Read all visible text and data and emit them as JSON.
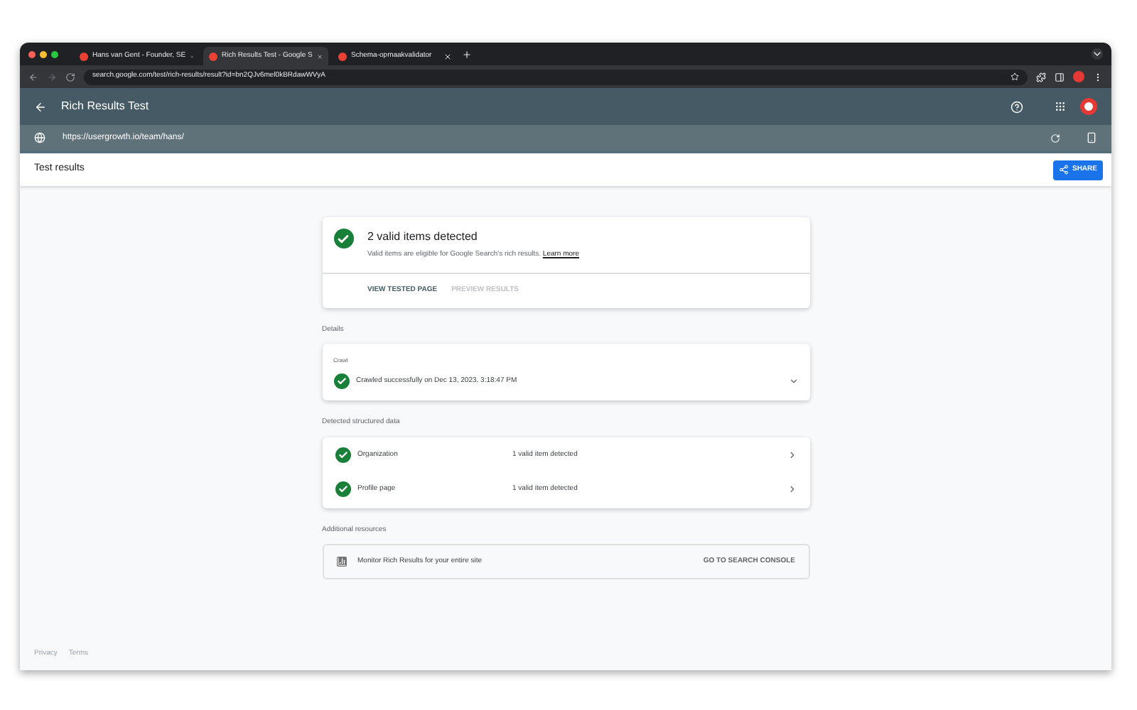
{
  "browser_tabs": [
    {
      "title": "Hans van Gent - Founder, SE",
      "selected": false
    },
    {
      "title": "Rich Results Test - Google S",
      "selected": true
    },
    {
      "title": "Schema-opmaakvalidator",
      "selected": false
    }
  ],
  "address": "search.google.com/test/rich-results/result?id=bn2QJv6mel0kBRdawWVyA",
  "app": {
    "title": "Rich Results Test",
    "tested_url": "https://usergrowth.io/team/hans/"
  },
  "toolbar": {
    "title": "Test results",
    "share_button": "SHARE"
  },
  "summary": {
    "heading": "2 valid items detected",
    "description": "Valid items are eligible for Google Search's rich results.",
    "link": "Learn more",
    "tabs": [
      {
        "label": "VIEW TESTED PAGE",
        "selected": true
      },
      {
        "label": "PREVIEW RESULTS",
        "selected": false
      }
    ]
  },
  "details": {
    "label": "Details",
    "card_label": "Crawl",
    "status": "Crawled successfully on Dec 13, 2023, 3:18:47 PM"
  },
  "structured_data": {
    "label": "Detected structured data",
    "rows": [
      {
        "name": "Organization",
        "result": "1 valid item detected"
      },
      {
        "name": "Profile page",
        "result": "1 valid item detected"
      }
    ]
  },
  "resources": {
    "label": "Additional resources",
    "text": "Monitor Rich Results for your entire site",
    "action": "GO TO SEARCH CONSOLE"
  },
  "footer": [
    "Privacy",
    "Terms"
  ]
}
